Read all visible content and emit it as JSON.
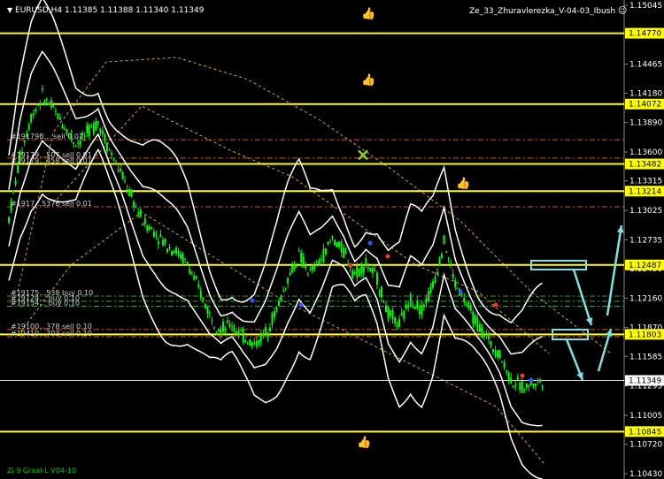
{
  "header": {
    "symbol_line": "EURUSD,H4  1.11385 1.11388 1.11340 1.11349",
    "expert_name": "Ze_33_Zhuravlerezka_V-04-03_Ibush"
  },
  "footer": {
    "indicator_name": "Zi 9 Graal-L V04-10"
  },
  "colors": {
    "background": "#000000",
    "level_line": "#ffff00",
    "candle": "#00ff00",
    "band": "#ffffff",
    "channel_dotted": "#d4b000",
    "arrow": "#7fe0e0"
  },
  "chart_data": {
    "type": "candlestick",
    "symbol": "EURUSD",
    "timeframe": "H4",
    "ylim": [
      1.1043,
      1.15045
    ],
    "axis_ticks": [
      "1.15045",
      "1.14465",
      "1.14180",
      "1.13890",
      "1.13600",
      "1.13315",
      "1.13025",
      "1.12735",
      "1.12450",
      "1.12160",
      "1.11870",
      "1.11585",
      "1.11295",
      "1.11005",
      "1.10720",
      "1.10430"
    ],
    "level_lines": [
      "1.14770",
      "1.14072",
      "1.13482",
      "1.13214",
      "1.12487",
      "1.11803",
      "1.10845"
    ],
    "current_price": "1.11349",
    "close_path": [
      1.1295,
      1.1355,
      1.1395,
      1.1415,
      1.1402,
      1.1385,
      1.1368,
      1.1378,
      1.139,
      1.1362,
      1.134,
      1.1315,
      1.1292,
      1.1282,
      1.127,
      1.1262,
      1.125,
      1.1225,
      1.12,
      1.1185,
      1.119,
      1.1178,
      1.117,
      1.1182,
      1.1205,
      1.1235,
      1.1258,
      1.124,
      1.1255,
      1.1275,
      1.1262,
      1.124,
      1.125,
      1.1235,
      1.12,
      1.119,
      1.1215,
      1.1205,
      1.1228,
      1.1272,
      1.123,
      1.121,
      1.119,
      1.1175,
      1.116,
      1.1135,
      1.1128,
      1.1132,
      1.1135
    ],
    "order_labels": [
      {
        "text": "#19179B… sell 0.01",
        "price": 1.1372
      },
      {
        "text": "#19179…507 sell 0.01",
        "price": 1.1354
      },
      {
        "text": "#19179…458 sell 0.01",
        "price": 1.1348
      },
      {
        "text": "#1917…5376 sell 0.01",
        "price": 1.1306
      },
      {
        "text": "#19175…538 buy 0.10",
        "price": 1.1218
      },
      {
        "text": "#19124… buy 0.10",
        "price": 1.1213
      },
      {
        "text": "#19154… buy 0.10",
        "price": 1.1208
      },
      {
        "text": "#19100…378 sell 0.10",
        "price": 1.1185
      },
      {
        "text": "#19410…703 sell 0.10",
        "price": 1.1178
      }
    ],
    "order_lines": [
      1.1372,
      1.1354,
      1.1348,
      1.1306,
      1.1218,
      1.1213,
      1.1208,
      1.1185,
      1.1178
    ],
    "markers": {
      "thumbs": [
        [
          413,
          1.1497
        ],
        [
          413,
          1.1432
        ],
        [
          520,
          1.133
        ],
        [
          408,
          1.1075
        ]
      ],
      "cross": [
        410,
        1.1357
      ]
    }
  }
}
